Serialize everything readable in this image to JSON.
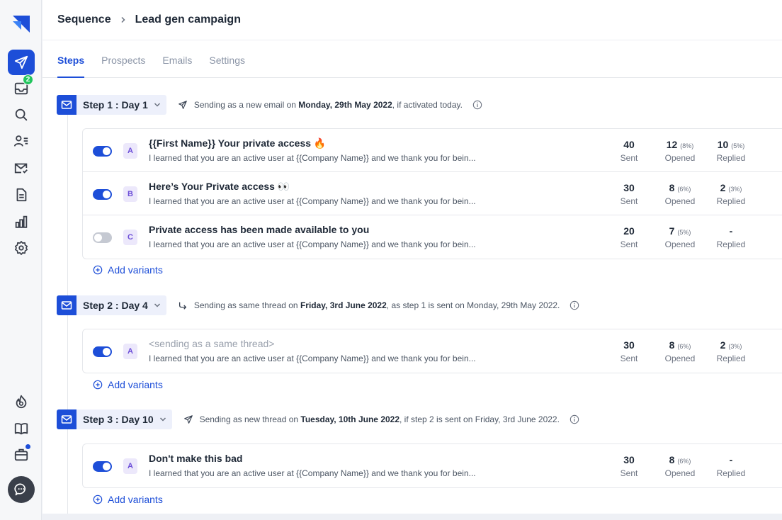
{
  "breadcrumb": {
    "parent": "Sequence",
    "current": "Lead gen campaign"
  },
  "tabs": [
    {
      "label": "Steps"
    },
    {
      "label": "Prospects"
    },
    {
      "label": "Emails"
    },
    {
      "label": "Settings"
    }
  ],
  "sidebar": {
    "inbox_badge": "2"
  },
  "add_variants_label": "Add variants",
  "steps": [
    {
      "label": "Step 1 : Day 1",
      "note_prefix": "Sending as a new email on ",
      "note_date": "Monday, 29th May 2022",
      "note_suffix": ", if activated today.",
      "variants": [
        {
          "letter": "A",
          "enabled": true,
          "subject": "{{First Name}} Your private access 🔥",
          "preview": "I learned that you are an active user at {{Company Name}} and we thank you for bein...",
          "sent": "40",
          "sent_label": "Sent",
          "opened": "12",
          "opened_pct": "(8%)",
          "opened_label": "Opened",
          "replied": "10",
          "replied_pct": "(5%)",
          "replied_label": "Replied"
        },
        {
          "letter": "B",
          "enabled": true,
          "subject": "Here’s Your Private access 👀",
          "preview": "I learned that you are an active user at {{Company Name}} and we thank you for bein...",
          "sent": "30",
          "sent_label": "Sent",
          "opened": "8",
          "opened_pct": "(6%)",
          "opened_label": "Opened",
          "replied": "2",
          "replied_pct": "(3%)",
          "replied_label": "Replied"
        },
        {
          "letter": "C",
          "enabled": false,
          "subject": "Private access has been made available to you",
          "preview": "I learned that you are an active user at {{Company Name}} and we thank you for bein...",
          "sent": "20",
          "sent_label": "Sent",
          "opened": "7",
          "opened_pct": "(5%)",
          "opened_label": "Opened",
          "replied": "-",
          "replied_pct": "",
          "replied_label": "Replied"
        }
      ]
    },
    {
      "label": "Step 2 : Day 4",
      "note_prefix": "Sending as same thread on ",
      "note_date": "Friday, 3rd June 2022",
      "note_suffix": ", as step 1 is sent on Monday, 29th May 2022.",
      "variants": [
        {
          "letter": "A",
          "enabled": true,
          "subject": "<sending as a same thread>",
          "preview": "I learned that you are an active user at {{Company Name}} and we thank you for bein...",
          "sent": "30",
          "sent_label": "Sent",
          "opened": "8",
          "opened_pct": "(6%)",
          "opened_label": "Opened",
          "replied": "2",
          "replied_pct": "(3%)",
          "replied_label": "Replied"
        }
      ]
    },
    {
      "label": "Step 3 : Day 10",
      "note_prefix": "Sending as new thread on ",
      "note_date": "Tuesday, 10th June 2022",
      "note_suffix": ", if step 2 is sent on Friday, 3rd June 2022.",
      "variants": [
        {
          "letter": "A",
          "enabled": true,
          "subject": "Don't make this bad",
          "preview": "I learned that you are an active user at {{Company Name}} and we thank you for bein...",
          "sent": "30",
          "sent_label": "Sent",
          "opened": "8",
          "opened_pct": "(6%)",
          "opened_label": "Opened",
          "replied": "-",
          "replied_pct": "",
          "replied_label": "Replied"
        }
      ]
    }
  ]
}
